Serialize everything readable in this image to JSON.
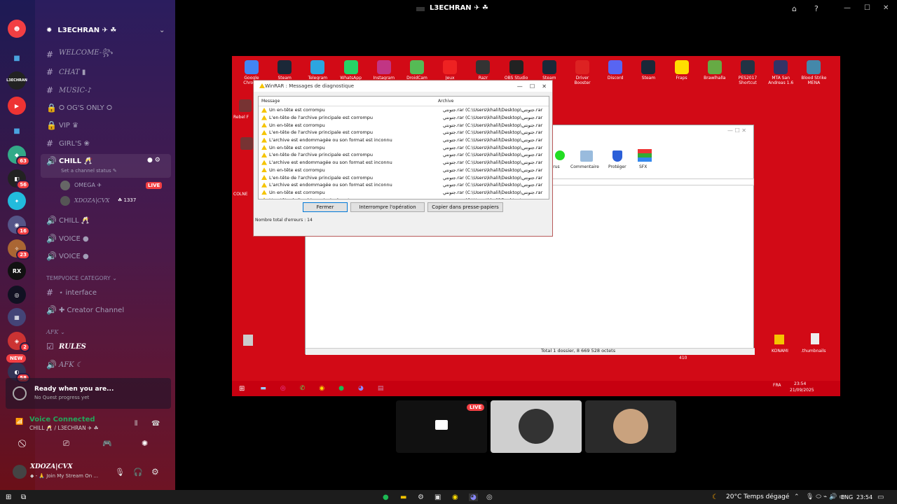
{
  "window": {
    "title": "L3ECHRAN ✈ ☘"
  },
  "server": {
    "name": "L3ECHRAN ✈ ☘"
  },
  "rail_badges": [
    "63",
    "56",
    "16",
    "23",
    "2",
    "58"
  ],
  "rail_new": "NEW",
  "rail_labels": [
    "L3ECHRAN",
    "RX"
  ],
  "channels": [
    {
      "sym": "#",
      "label": "WELCOME-꧂",
      "style": "italic"
    },
    {
      "sym": "#",
      "label": "CHAT ▮",
      "style": "italic"
    },
    {
      "sym": "#",
      "label": "MUSIC-♪",
      "style": "italic"
    },
    {
      "sym": "🔒",
      "label": "⭘ OG'S ONLY ⭘",
      "style": "plain"
    },
    {
      "sym": "#",
      "label": "VIP ♛",
      "style": "plain"
    },
    {
      "sym": "#",
      "label": "GIRL'S ❀",
      "style": "plain"
    }
  ],
  "active_channel": {
    "label": "CHILL 🥂",
    "status": "Set a channel status ✎"
  },
  "voice_users": [
    {
      "name": "OMEGA ✈",
      "badge": "LIVE"
    },
    {
      "name": "XDOZA|CVX",
      "tag": "☘ 1337"
    }
  ],
  "voice_channels": [
    "CHILL 🥂",
    "VOICE ●",
    "VOICE ●"
  ],
  "category": "TEMPVOICE CATEGORY ⌄",
  "temp_channels": [
    "⋆ interface",
    "✚ Creator Channel"
  ],
  "afk_category": "AFK ⌄",
  "rules": "RULES",
  "afk": "AFK ☾",
  "quest": {
    "title": "Ready when you are...",
    "sub": "No Quest progress yet"
  },
  "voice": {
    "status": "Voice Connected",
    "channel": "CHILL 🥂 / L3ECHRAN ✈ ☘"
  },
  "user": {
    "name": "XDOZA|CVX",
    "status": "◆ - 🙏 Join My Stream On ..."
  },
  "desktop_icons": [
    "Google Chrome",
    "Steam",
    "Telegram",
    "WhatsApp",
    "Instagram",
    "DroidCam",
    "Jeux",
    "Razr",
    "OBS Studio",
    "Steam",
    "Driver Booster",
    "Discord",
    "Steam",
    "Fraps",
    "Brawlhalla",
    "PES2017 Shortcut",
    "MTA San Andreas 1.6",
    "Blood Strike MENA"
  ],
  "desktop_left": [
    "Rebel F",
    "COLNE"
  ],
  "winrar": {
    "title": "WinRAR : Messages de diagnostique",
    "col_message": "Message",
    "col_archive": "Archive",
    "rows": [
      "Un en-tête est corrompu",
      "L'en-tête de l'archive principale est corrompu",
      "Un en-tête est corrompu",
      "L'en-tête de l'archive principale est corrompu",
      "L'archive est endommagée ou son format est inconnu",
      "Un en-tête est corrompu",
      "L'en-tête de l'archive principale est corrompu",
      "L'archive est endommagée ou son format est inconnu",
      "Un en-tête est corrompu",
      "L'en-tête de l'archive principale est corrompu",
      "L'archive est endommagée ou son format est inconnu",
      "Un en-tête est corrompu",
      "L'en-tête de l'archive principale est corrompu"
    ],
    "archive_path": "جتونتي.rar (C:\\Users\\khalil\\Desktop\\جتونتي.rar",
    "btn_close": "Fermer",
    "btn_stop": "Interrompre l'opération",
    "btn_copy": "Copier dans presse-papiers",
    "total": "Nombre total d'erreurs : 14"
  },
  "toolbar": [
    "virus",
    "Commentaire",
    "Protéger",
    "SFX"
  ],
  "status_bar": "Total 1 dossier, 8 669 528 octets",
  "desktop_right": [
    "KONAMI",
    ".thumbnails"
  ],
  "inner_clock": {
    "time": "23:54",
    "date": "21/09/2025",
    "lang": "FRA"
  },
  "inner_410": "410",
  "stream_live": "LIVE",
  "win_clock": {
    "time": "23:54",
    "lang": "ENG"
  },
  "weather": "20°C  Temps dégagé",
  "colors": {
    "red": "#d20a16",
    "discord": "#5865f2"
  }
}
